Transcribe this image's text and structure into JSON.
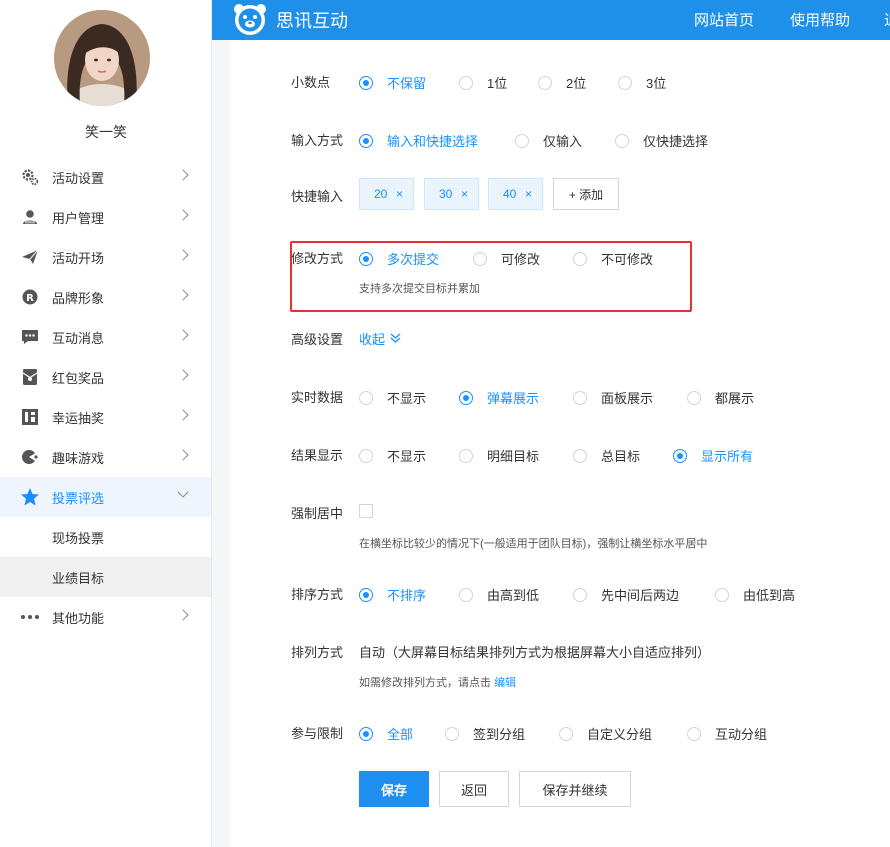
{
  "sidebar": {
    "username": "笑一笑",
    "items": [
      {
        "label": "活动设置",
        "icon": "gear-icon"
      },
      {
        "label": "用户管理",
        "icon": "user-icon"
      },
      {
        "label": "活动开场",
        "icon": "paper-plane-icon"
      },
      {
        "label": "品牌形象",
        "icon": "registered-icon"
      },
      {
        "label": "互动消息",
        "icon": "chat-icon"
      },
      {
        "label": "红包奖品",
        "icon": "red-envelope-icon"
      },
      {
        "label": "幸运抽奖",
        "icon": "lottery-icon"
      },
      {
        "label": "趣味游戏",
        "icon": "game-icon"
      },
      {
        "label": "投票评选",
        "icon": "star-icon"
      }
    ],
    "submenu": [
      {
        "label": "现场投票"
      },
      {
        "label": "业绩目标"
      }
    ],
    "other": {
      "label": "其他功能",
      "icon": "more-icon"
    }
  },
  "header": {
    "brand": "思讯互动",
    "nav": [
      "网站首页",
      "使用帮助",
      "退"
    ]
  },
  "form": {
    "decimal": {
      "label": "小数点",
      "options": [
        "不保留",
        "1位",
        "2位",
        "3位"
      ],
      "selected": 0
    },
    "input_mode": {
      "label": "输入方式",
      "options": [
        "输入和快捷选择",
        "仅输入",
        "仅快捷选择"
      ],
      "selected": 0
    },
    "quick_input": {
      "label": "快捷输入",
      "tags": [
        "20",
        "30",
        "40"
      ],
      "remove_glyph": "×",
      "add_label": "+ 添加"
    },
    "modify_mode": {
      "label": "修改方式",
      "options": [
        "多次提交",
        "可修改",
        "不可修改"
      ],
      "selected": 0,
      "hint": "支持多次提交目标并累加"
    },
    "advanced": {
      "label": "高级设置",
      "toggle": "收起"
    },
    "realtime": {
      "label": "实时数据",
      "options": [
        "不显示",
        "弹幕展示",
        "面板展示",
        "都展示"
      ],
      "selected": 1
    },
    "result": {
      "label": "结果显示",
      "options": [
        "不显示",
        "明细目标",
        "总目标",
        "显示所有"
      ],
      "selected": 3
    },
    "force_center": {
      "label": "强制居中",
      "hint": "在横坐标比较少的情况下(一般适用于团队目标)，强制让横坐标水平居中"
    },
    "sort": {
      "label": "排序方式",
      "options": [
        "不排序",
        "由高到低",
        "先中间后两边",
        "由低到高"
      ],
      "selected": 0
    },
    "arrange": {
      "label": "排列方式",
      "value": "自动（大屏幕目标结果排列方式为根据屏幕大小自适应排列）",
      "hint_prefix": "如需修改排列方式，请点击",
      "hint_link": "编辑"
    },
    "limit": {
      "label": "参与限制",
      "options": [
        "全部",
        "签到分组",
        "自定义分组",
        "互动分组"
      ],
      "selected": 0
    }
  },
  "actions": {
    "save": "保存",
    "back": "返回",
    "save_continue": "保存并继续"
  },
  "colors": {
    "primary": "#1e90ea",
    "highlight_box": "#e83030"
  }
}
